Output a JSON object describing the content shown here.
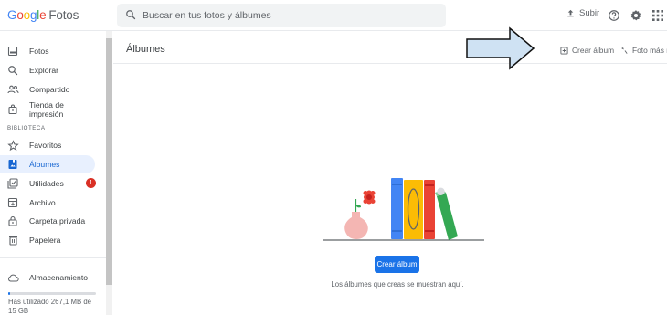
{
  "app": {
    "logo_parts": [
      "G",
      "o",
      "o",
      "g",
      "l",
      "e"
    ],
    "product": "Fotos"
  },
  "search": {
    "placeholder": "Buscar en tus fotos y álbumes"
  },
  "header": {
    "upload_label": "Subir"
  },
  "sidebar": {
    "items": [
      {
        "label": "Fotos",
        "icon": "photo-icon"
      },
      {
        "label": "Explorar",
        "icon": "search-icon"
      },
      {
        "label": "Compartido",
        "icon": "people-icon"
      },
      {
        "label": "Tienda de impresión",
        "icon": "shopping-bag-icon"
      }
    ],
    "library_title": "BIBLIOTECA",
    "library_items": [
      {
        "label": "Favoritos",
        "icon": "star-icon"
      },
      {
        "label": "Álbumes",
        "icon": "album-icon",
        "active": true
      },
      {
        "label": "Utilidades",
        "icon": "utilities-icon",
        "badge": "1"
      },
      {
        "label": "Archivo",
        "icon": "archive-icon"
      },
      {
        "label": "Carpeta privada",
        "icon": "lock-icon"
      },
      {
        "label": "Papelera",
        "icon": "trash-icon"
      }
    ],
    "storage": {
      "label": "Almacenamiento",
      "used_text": "Has utilizado 267,1 MB de 15 GB",
      "used_fraction": 0.02
    }
  },
  "main": {
    "title": "Álbumes",
    "actions": {
      "create_album": "Crear álbum",
      "photo_book": "Foto más re"
    },
    "empty_state": {
      "button_label": "Crear álbum",
      "message": "Los álbumes que creas se muestran aquí."
    }
  },
  "colors": {
    "accent": "#1a73e8",
    "active_bg": "#e8f0fe",
    "badge": "#d93025"
  }
}
